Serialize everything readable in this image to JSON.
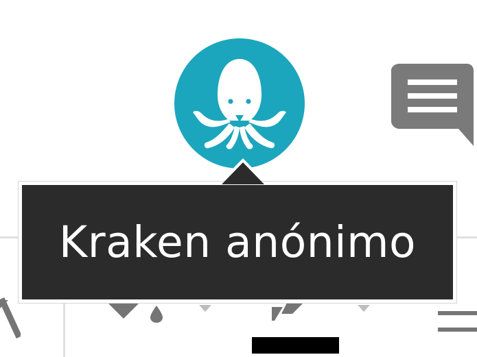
{
  "avatar": {
    "icon": "kraken-icon",
    "background_color": "#1ba6bd"
  },
  "comment_button": {
    "icon": "comment-icon",
    "color": "#7a7a7a"
  },
  "tooltip": {
    "text": "Kraken anónimo",
    "background_color": "#2b2b2b",
    "text_color": "#ffffff"
  },
  "toolbar": {
    "icons": [
      "back-arrow-icon",
      "fill-icon",
      "dropdown-arrow-icon",
      "pencil-icon",
      "dropdown-arrow-icon",
      "menu-lines-icon"
    ],
    "icon_color": "#757575"
  }
}
